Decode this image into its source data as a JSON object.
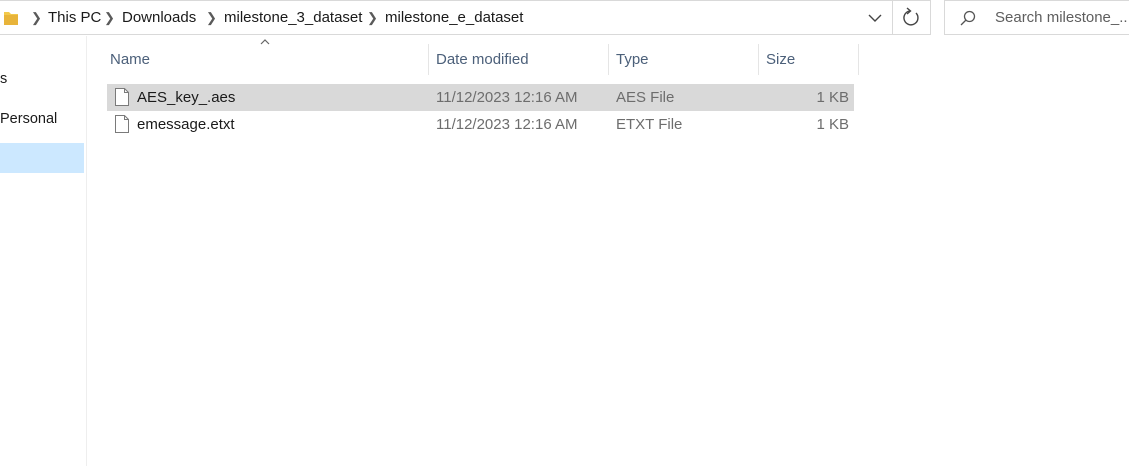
{
  "address_bar": {
    "breadcrumbs": [
      "This PC",
      "Downloads",
      "milestone_3_dataset",
      "milestone_e_dataset"
    ],
    "icon": "folder-icon"
  },
  "search": {
    "placeholder": "Search milestone_..."
  },
  "navigation": {
    "items": [
      {
        "label": "s",
        "selected": false
      },
      {
        "label": "Personal",
        "selected": false
      },
      {
        "label": "",
        "selected": true
      }
    ]
  },
  "columns": {
    "name": "Name",
    "date_modified": "Date modified",
    "type": "Type",
    "size": "Size"
  },
  "files": [
    {
      "name": "AES_key_.aes",
      "date_modified": "11/12/2023 12:16 AM",
      "type": "AES File",
      "size": "1 KB",
      "selected": true,
      "icon": "file-icon"
    },
    {
      "name": "emessage.etxt",
      "date_modified": "11/12/2023 12:16 AM",
      "type": "ETXT File",
      "size": "1 KB",
      "selected": false,
      "icon": "file-icon"
    }
  ],
  "colors": {
    "selected_row": "#d9d9d9",
    "selected_nav": "#cce8ff",
    "header_text": "#4c607a",
    "folder": "#f2c94c"
  }
}
